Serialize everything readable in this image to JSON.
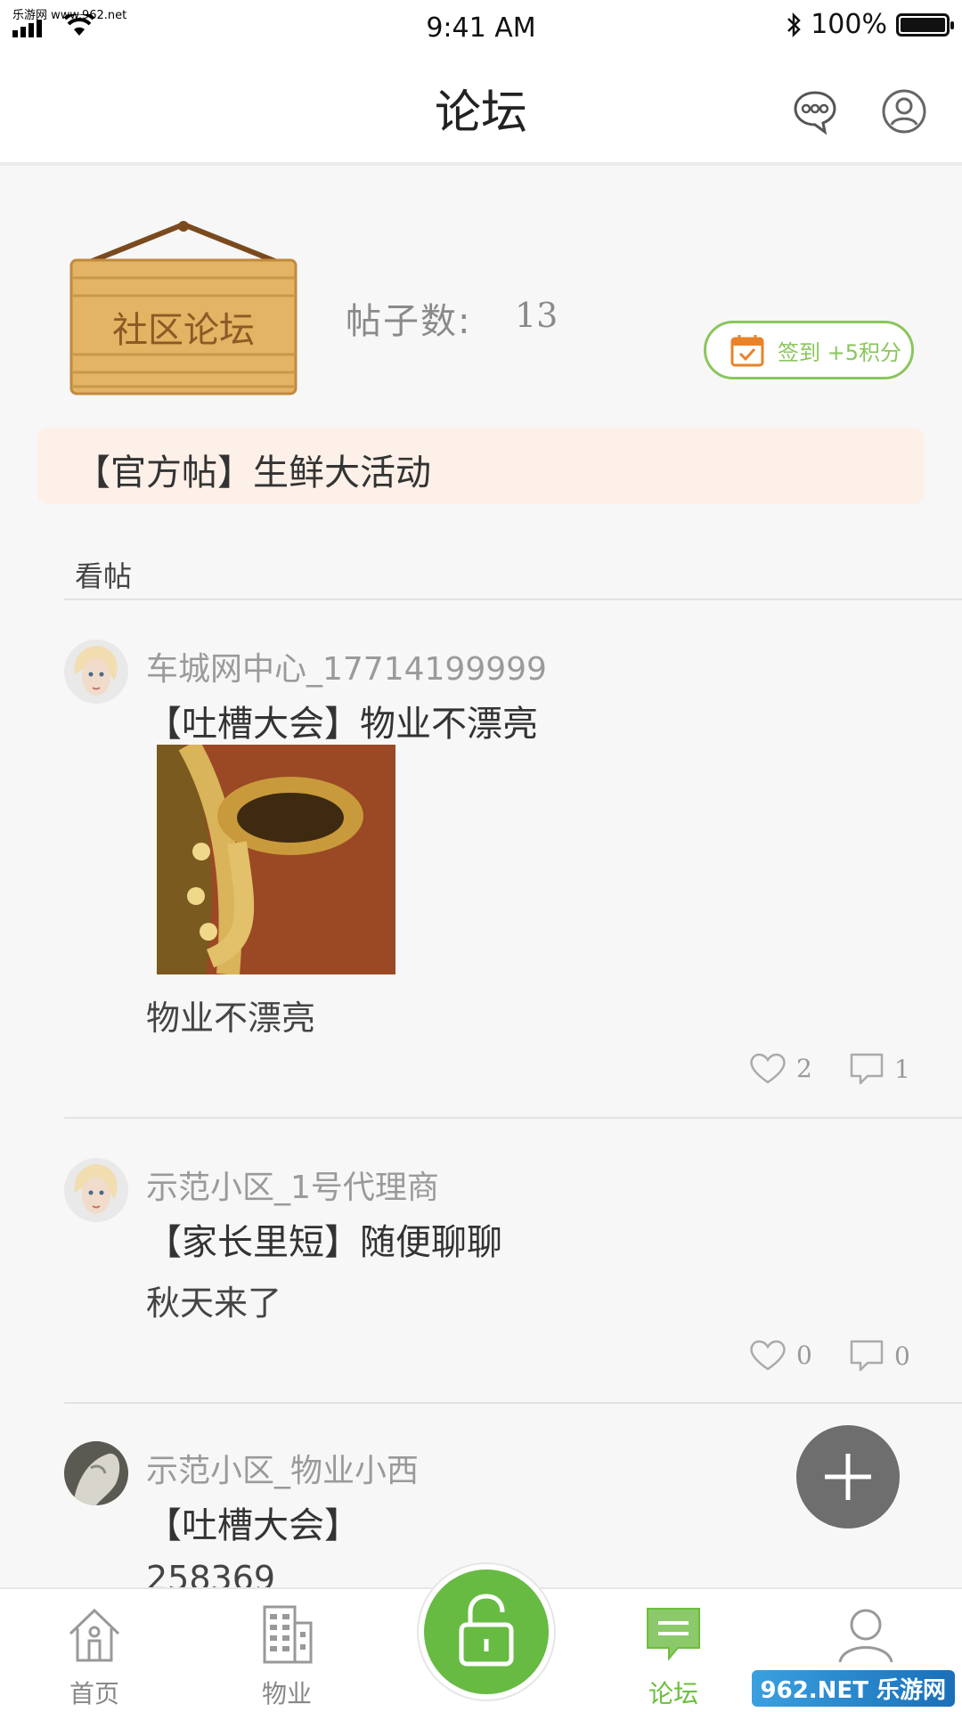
{
  "status_bar": {
    "carrier": "乐游网 www.962.net",
    "time": "9:41 AM",
    "battery": "100%"
  },
  "nav": {
    "title": "论坛",
    "icons": [
      "chat-bubble-icon",
      "user-profile-icon"
    ]
  },
  "forum_header": {
    "sign_text": "社区论坛",
    "post_count_label": "帖子数:",
    "post_count_value": "13",
    "checkin_label": "签到 +5积分"
  },
  "official_post": "【官方帖】生鲜大活动",
  "section_title": "看帖",
  "posts": [
    {
      "user": "车城网中心_17714199999",
      "title": "【吐槽大会】物业不漂亮",
      "body": "物业不漂亮",
      "likes": "2",
      "comments": "1",
      "has_image": true
    },
    {
      "user": "示范小区_1号代理商",
      "title": "【家长里短】随便聊聊",
      "body": "秋天来了",
      "likes": "0",
      "comments": "0",
      "has_image": false
    },
    {
      "user": "示范小区_物业小西",
      "title": "【吐槽大会】",
      "body": "258369"
    }
  ],
  "tabs": [
    {
      "label": "首页",
      "icon": "home-icon"
    },
    {
      "label": "物业",
      "icon": "building-icon"
    },
    {
      "label": "",
      "icon": "unlock-icon"
    },
    {
      "label": "论坛",
      "icon": "forum-icon",
      "active": true
    },
    {
      "label": "",
      "icon": "user-icon"
    }
  ],
  "watermark": "962.NET 乐游网",
  "colors": {
    "accent_green": "#67bb43",
    "checkin_green": "#8ac65d",
    "official_bg": "#fdf0e8",
    "fab_gray": "#6e6e6e"
  }
}
